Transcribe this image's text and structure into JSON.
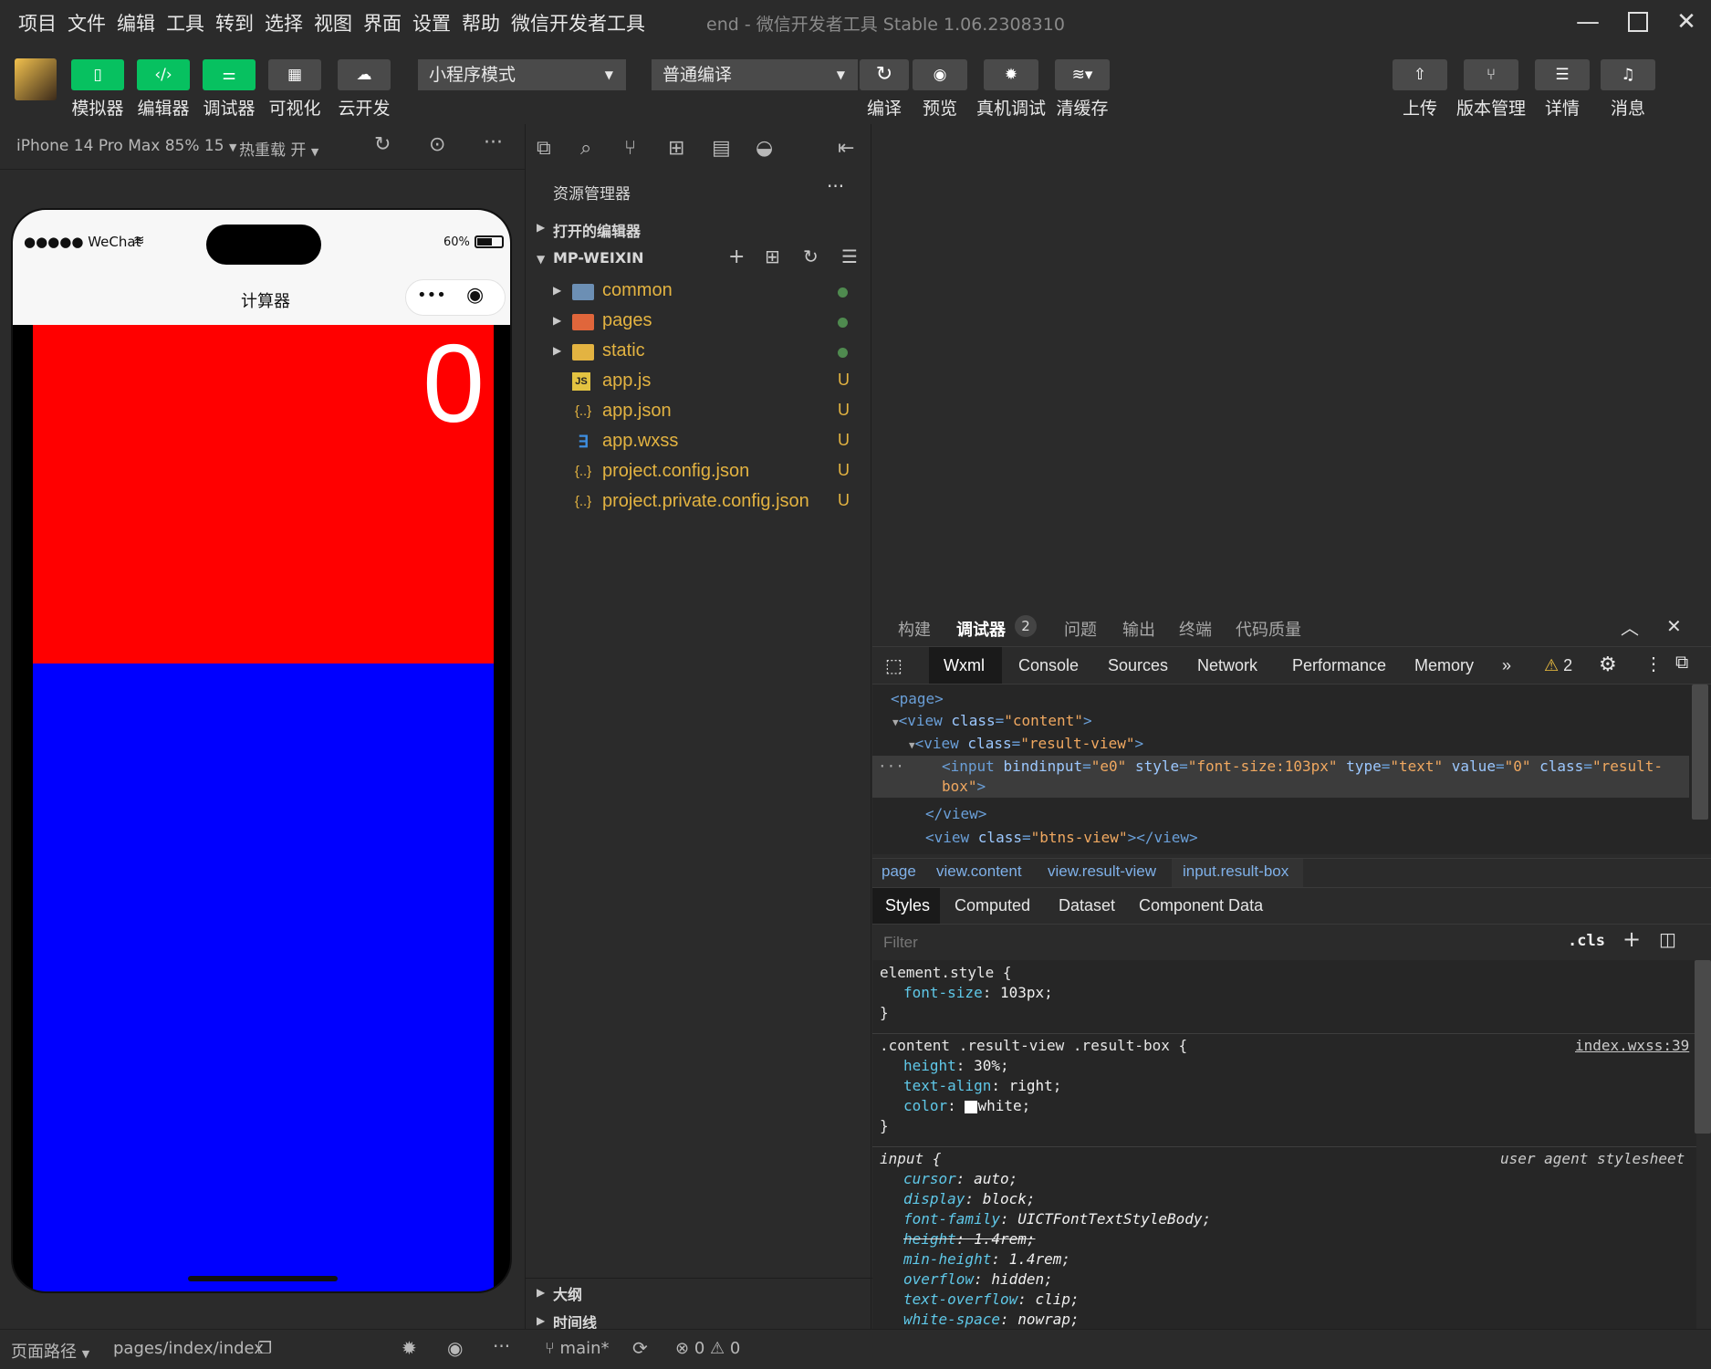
{
  "menubar": {
    "items": [
      "项目",
      "文件",
      "编辑",
      "工具",
      "转到",
      "选择",
      "视图",
      "界面",
      "设置",
      "帮助",
      "微信开发者工具"
    ],
    "title": "end - 微信开发者工具 Stable 1.06.2308310"
  },
  "toolbar": {
    "left_buttons": [
      {
        "label": "模拟器",
        "icon": "phone-icon"
      },
      {
        "label": "编辑器",
        "icon": "code-icon"
      },
      {
        "label": "调试器",
        "icon": "debug-sliders-icon"
      },
      {
        "label": "可视化",
        "icon": "layout-icon"
      },
      {
        "label": "云开发",
        "icon": "cloud-icon"
      }
    ],
    "mode_select": "小程序模式",
    "compile_select": "普通编译",
    "mid_buttons": [
      {
        "label": "编译",
        "icon": "refresh-icon"
      },
      {
        "label": "预览",
        "icon": "eye-icon"
      },
      {
        "label": "真机调试",
        "icon": "bug-icon"
      },
      {
        "label": "清缓存",
        "icon": "layers-icon"
      }
    ],
    "right_buttons": [
      {
        "label": "上传",
        "icon": "upload-icon"
      },
      {
        "label": "版本管理",
        "icon": "branch-icon"
      },
      {
        "label": "详情",
        "icon": "menu-icon"
      },
      {
        "label": "消息",
        "icon": "bell-icon"
      }
    ]
  },
  "simulator": {
    "device": "iPhone 14 Pro Max 85% 15",
    "hot_reload": "热重载 开",
    "status_carrier": "●●●●● WeChat",
    "battery": "60%",
    "page_title": "计算器",
    "result_value": "0",
    "colors": {
      "result_bg": "#ff0000",
      "buttons_bg": "#0000ff"
    }
  },
  "sim_footer": {
    "path_label": "页面路径",
    "path_value": "pages/index/index"
  },
  "explorer": {
    "title": "资源管理器",
    "open_editors": "打开的编辑器",
    "project": "MP-WEIXIN",
    "files": [
      {
        "name": "common",
        "type": "folder",
        "status": "dot"
      },
      {
        "name": "pages",
        "type": "folder",
        "status": "dot"
      },
      {
        "name": "static",
        "type": "folder",
        "status": "dot"
      },
      {
        "name": "app.js",
        "type": "js",
        "status": "U"
      },
      {
        "name": "app.json",
        "type": "json",
        "status": "U"
      },
      {
        "name": "app.wxss",
        "type": "css",
        "status": "U"
      },
      {
        "name": "project.config.json",
        "type": "json",
        "status": "U"
      },
      {
        "name": "project.private.config.json",
        "type": "json",
        "status": "U"
      }
    ],
    "outline": "大纲",
    "timeline": "时间线",
    "branch": "main*",
    "errors": "0",
    "warnings": "0"
  },
  "devtools": {
    "top_tabs": [
      "构建",
      "调试器",
      "问题",
      "输出",
      "终端",
      "代码质量"
    ],
    "debugger_badge": "2",
    "tabs": [
      "Wxml",
      "Console",
      "Sources",
      "Network",
      "Performance",
      "Memory"
    ],
    "warn_count": "2",
    "breadcrumb": [
      "page",
      "view.content",
      "view.result-view",
      "input.result-box"
    ],
    "style_tabs": [
      "Styles",
      "Computed",
      "Dataset",
      "Component Data"
    ],
    "filter_placeholder": "Filter",
    "cls": ".cls",
    "rule2_source": "index.wxss:39",
    "rule3_source": "user agent stylesheet"
  }
}
